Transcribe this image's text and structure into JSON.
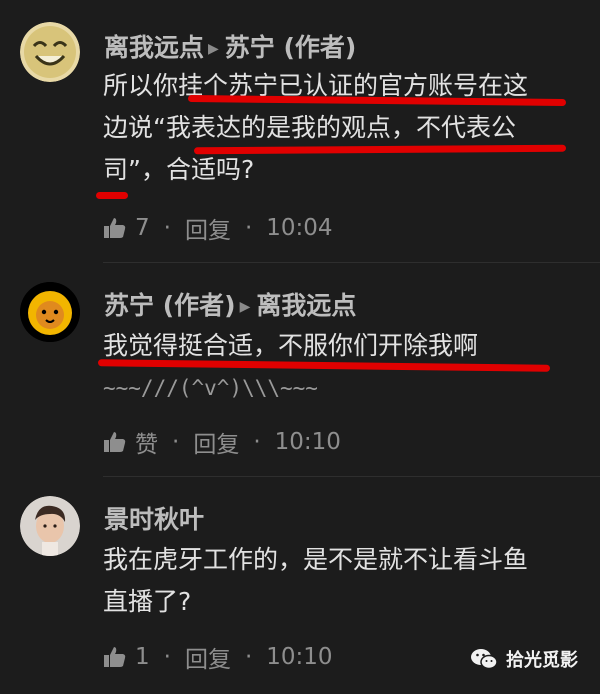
{
  "comments": [
    {
      "author": "离我远点",
      "reply_to": "苏宁 (作者)",
      "lines": [
        "所以你挂个苏宁已认证的官方账号在这",
        "边说“我表达的是我的观点，不代表公",
        "司”，合适吗?"
      ],
      "likes": "7",
      "reply_label": "回复",
      "time": "10:04"
    },
    {
      "author": "苏宁 (作者)",
      "reply_to": "离我远点",
      "lines": [
        "我觉得挺合适，不服你们开除我啊",
        "~~~///(^v^)\\\\\\~~~"
      ],
      "likes": "赞",
      "reply_label": "回复",
      "time": "10:10"
    },
    {
      "author": "景时秋叶",
      "reply_to": "",
      "lines": [
        "我在虎牙工作的，是不是就不让看斗鱼",
        "直播了?"
      ],
      "likes": "1",
      "reply_label": "回复",
      "time": "10:10"
    }
  ],
  "separator_dot": "·",
  "watermark": "拾光觅影",
  "colors": {
    "background": "#1c1c1c",
    "underline": "#e00000",
    "meta": "#8e8e8e"
  },
  "icons": {
    "like": "thumbs-up-icon",
    "arrow": "triangle-right-icon",
    "watermark": "wechat-icon"
  }
}
